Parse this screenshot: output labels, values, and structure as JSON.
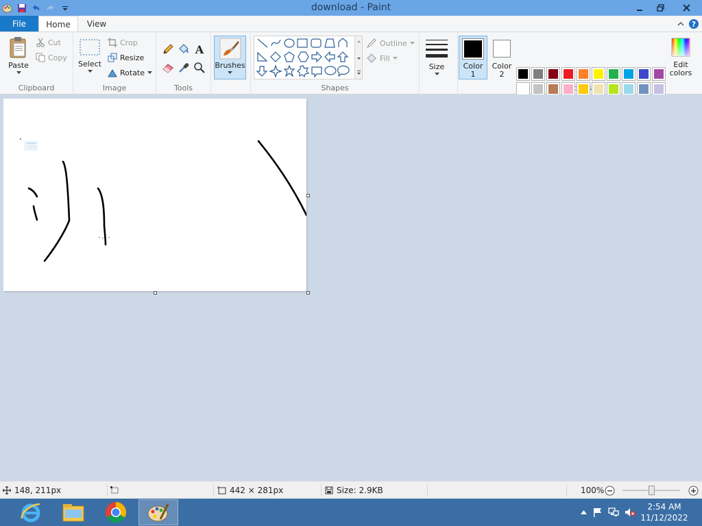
{
  "window": {
    "title": "download - Paint"
  },
  "tabs": {
    "file": "File",
    "home": "Home",
    "view": "View"
  },
  "clipboard": {
    "group_label": "Clipboard",
    "paste": "Paste",
    "cut": "Cut",
    "copy": "Copy"
  },
  "image": {
    "group_label": "Image",
    "select": "Select",
    "crop": "Crop",
    "resize": "Resize",
    "rotate": "Rotate"
  },
  "tools": {
    "group_label": "Tools"
  },
  "brushes": {
    "label": "Brushes"
  },
  "shapes": {
    "group_label": "Shapes",
    "outline": "Outline",
    "fill": "Fill"
  },
  "size": {
    "label": "Size"
  },
  "colors": {
    "group_label": "Colors",
    "color1_line1": "Color",
    "color1_line2": "1",
    "color2_line1": "Color",
    "color2_line2": "2",
    "edit_line1": "Edit",
    "edit_line2": "colors",
    "color1_value": "#000000",
    "color2_value": "#ffffff",
    "palette": [
      "#000000",
      "#7f7f7f",
      "#880015",
      "#ed1c24",
      "#ff7f27",
      "#fff200",
      "#22b14c",
      "#00a2e8",
      "#3f48cc",
      "#a349a4",
      "#ffffff",
      "#c3c3c3",
      "#b97a57",
      "#ffaec9",
      "#ffc90e",
      "#efe4b0",
      "#b5e61d",
      "#99d9ea",
      "#7092be",
      "#c8bfe7",
      "",
      "",
      "",
      "",
      "",
      "",
      "",
      "",
      "",
      ""
    ]
  },
  "status": {
    "cursor_pos": "148, 211px",
    "canvas_size": "442 × 281px",
    "file_size": "Size: 2.9KB",
    "zoom": "100%"
  },
  "taskbar": {
    "time": "2:54 AM",
    "date": "11/12/2022"
  }
}
